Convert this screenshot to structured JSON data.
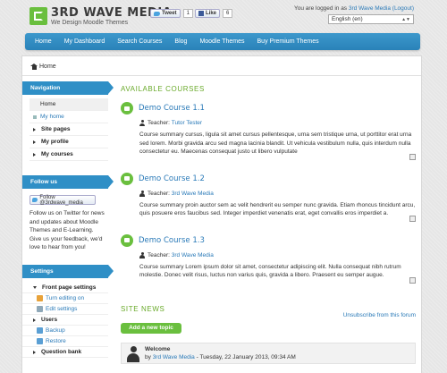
{
  "header": {
    "logo_title": "3RD WAVE MEDIA",
    "logo_subtitle": "We Design Moodle Themes",
    "tweet_label": "Tweet",
    "tweet_count": "1",
    "like_label": "Like",
    "like_count": "6",
    "login_prefix": "You are logged in as ",
    "login_user": "3rd Wave Media",
    "login_logout": "(Logout)",
    "language": "English (en)"
  },
  "nav": {
    "items": [
      "Home",
      "My Dashboard",
      "Search Courses",
      "Blog",
      "Moodle Themes",
      "Buy Premium Themes"
    ]
  },
  "breadcrumb": {
    "home": "Home"
  },
  "navigation_block": {
    "title": "Navigation",
    "items": [
      "Home",
      "My home",
      "Site pages",
      "My profile",
      "My courses"
    ]
  },
  "follow_block": {
    "title": "Follow us",
    "button": "Follow @3rdwave_media",
    "text": "Follow us on Twitter for news and updates about Moodle Themes and E-Learning. Give us your feedback, we'd love to hear from you!"
  },
  "settings_block": {
    "title": "Settings",
    "items": [
      "Front page settings",
      "Turn editing on",
      "Edit settings",
      "Users",
      "Backup",
      "Restore",
      "Question bank"
    ]
  },
  "main": {
    "available_title": "AVAILABLE COURSES",
    "teacher_label": "Teacher:",
    "courses": [
      {
        "name": "Demo Course 1.1",
        "teacher": "Tutor Tester",
        "summary": "Course summary cursus, ligula sit amet cursus pellentesque, urna sem tristique urna, ut porttitor erat urna sed lorem. Morbi gravida arcu sed magna lacinia blandit. Ut vehicula vestibulum nulla, quis interdum nulla consectetur eu. Maecenas consequat justo ut libero vulputate"
      },
      {
        "name": "Demo Course 1.2",
        "teacher": "3rd Wave Media",
        "summary": "Course summary proin auctor sem ac velit hendrerit eu semper nunc gravida. Etiam rhoncus tincidunt arcu, quis posuere eros faucibus sed. Integer imperdiet venenatis erat, eget convallis eros imperdiet a."
      },
      {
        "name": "Demo Course 1.3",
        "teacher": "3rd Wave Media",
        "summary": "Course summary Lorem ipsum dolor sit amet, consectetur adipiscing elit. Nulla consequat nibh rutrum molestie. Donec velit risus, luctus non varius quis, gravida a libero. Praesent eu semper augue."
      }
    ],
    "news_title": "SITE NEWS",
    "unsubscribe": "Unsubscribe from this forum",
    "add_topic": "Add a new topic",
    "post": {
      "title": "Welcome",
      "by": "by",
      "author": "3rd Wave Media",
      "date": " - Tuesday, 22 January 2013, 09:34 AM"
    }
  },
  "colors": {
    "accent_blue": "#2f8fc6",
    "accent_green": "#6abf3e",
    "link": "#2a7ab8"
  }
}
